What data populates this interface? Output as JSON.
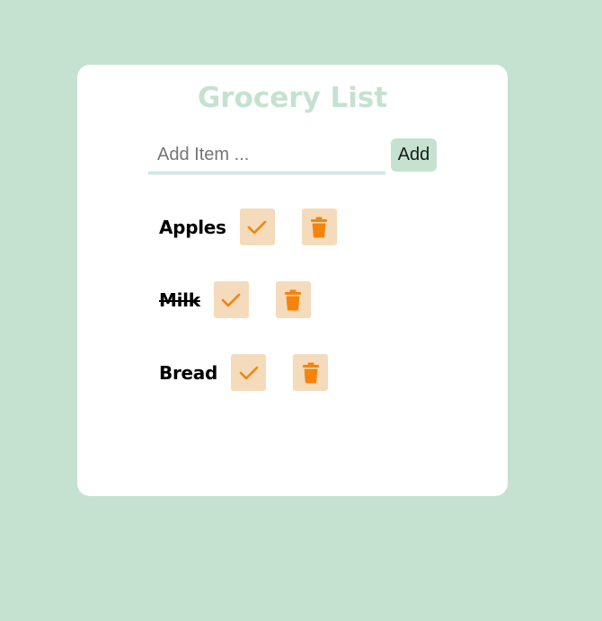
{
  "app": {
    "title": "Grocery List"
  },
  "form": {
    "input_value": "",
    "input_placeholder": "Add Item ...",
    "add_label": "Add"
  },
  "items": [
    {
      "label": "Apples",
      "done": false
    },
    {
      "label": "Milk",
      "done": true
    },
    {
      "label": "Bread",
      "done": false
    }
  ],
  "icons": {
    "complete": "check-icon",
    "delete": "trash-icon"
  },
  "colors": {
    "background": "#c5e2d1",
    "card": "#ffffff",
    "title": "#c5e2d1",
    "add_button": "#c5e2d1",
    "icon_button_bg": "#f3dbbb",
    "icon_accent": "#f5830d"
  }
}
